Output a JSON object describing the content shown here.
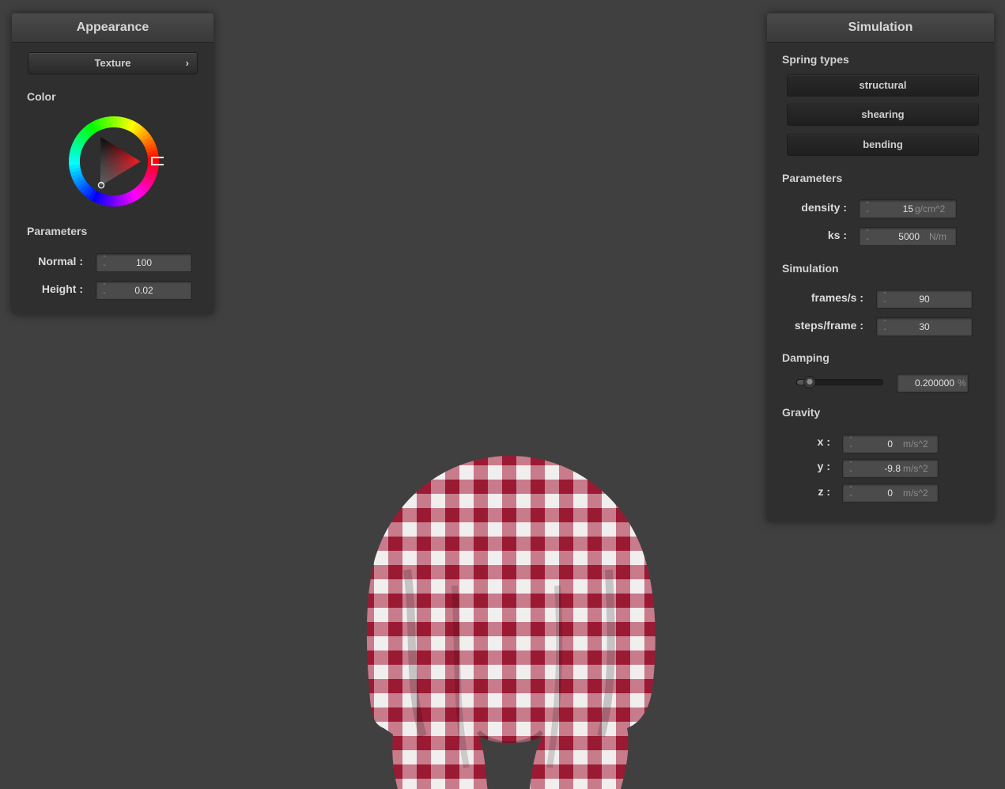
{
  "appearance": {
    "title": "Appearance",
    "texture_button": "Texture",
    "texture_chevron": "›",
    "color_label": "Color",
    "color_value": "#e8202a",
    "parameters_label": "Parameters",
    "normal_label": "Normal :",
    "normal_value": "100",
    "height_label": "Height :",
    "height_value": "0.02"
  },
  "simulation": {
    "title": "Simulation",
    "spring_types_label": "Spring types",
    "spring_types": [
      "structural",
      "shearing",
      "bending"
    ],
    "parameters_label": "Parameters",
    "density_label": "density :",
    "density_value": "15",
    "density_unit": "g/cm^2",
    "ks_label": "ks :",
    "ks_value": "5000",
    "ks_unit": "N/m",
    "simulation_label": "Simulation",
    "fps_label": "frames/s :",
    "fps_value": "90",
    "steps_label": "steps/frame :",
    "steps_value": "30",
    "damping_label": "Damping",
    "damping_value": "0.200000",
    "damping_unit": "%",
    "damping_fraction": 0.2,
    "gravity_label": "Gravity",
    "gx_label": "x :",
    "gx_value": "0",
    "gy_label": "y :",
    "gy_value": "-9.8",
    "gz_label": "z :",
    "gz_value": "0",
    "gravity_unit": "m/s^2"
  },
  "scene": {
    "cloth_colors": [
      "#a0203a",
      "#f2f2f2"
    ]
  }
}
